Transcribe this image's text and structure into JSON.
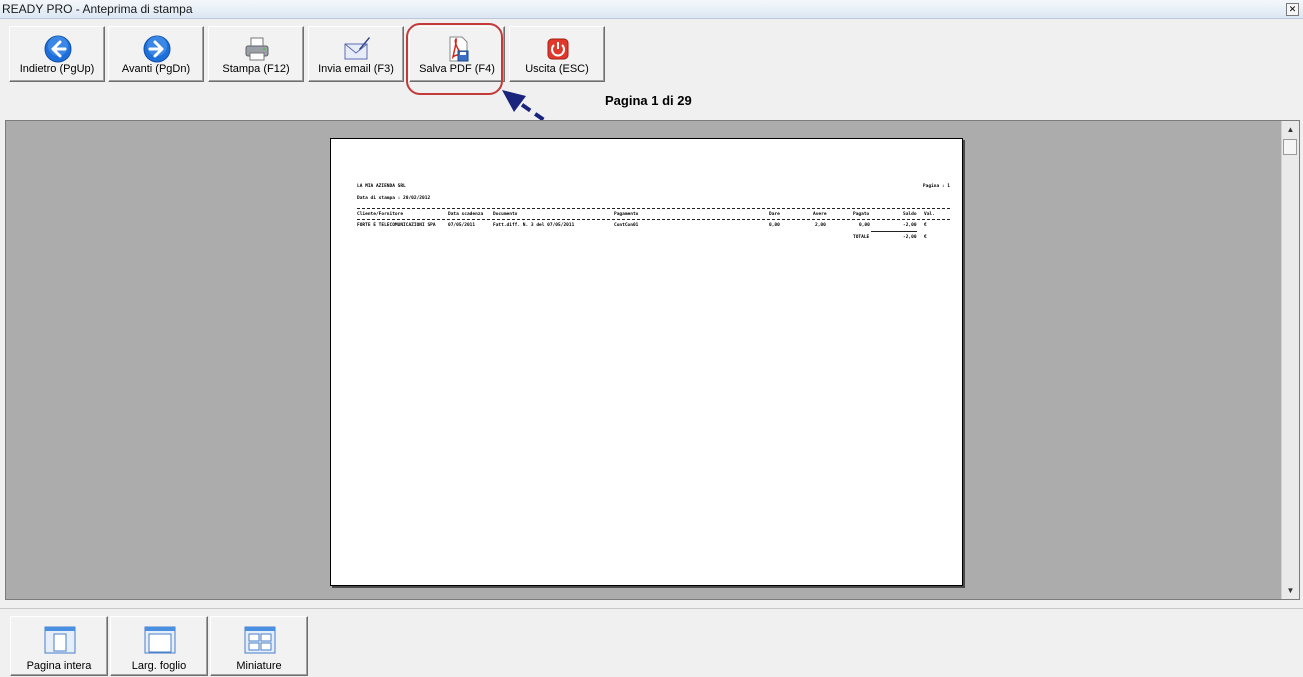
{
  "window": {
    "title": "READY PRO - Anteprima di stampa",
    "close_icon": "close-icon"
  },
  "toolbar": {
    "back_label": "Indietro (PgUp)",
    "forward_label": "Avanti (PgDn)",
    "print_label": "Stampa (F12)",
    "email_label": "Invia email (F3)",
    "pdf_label": "Salva PDF (F4)",
    "exit_label": "Uscita (ESC)"
  },
  "page_info": "Pagina 1 di 29",
  "report": {
    "company": "LA MIA AZIENDA SRL",
    "page_label": "Pagina : 1",
    "print_date": "Data di stampa : 20/02/2012",
    "columns": [
      "Cliente/Fornitore",
      "Data scadenza",
      "Documento",
      "Pagamento",
      "Dare",
      "Avere",
      "Pagato",
      "Saldo",
      "Val."
    ],
    "rows": [
      [
        "FORTE E TELECOMUNICAZIONI SPA",
        "07/05/2011",
        "Fatt.diff. N. 3 del 07/05/2011",
        "ContCon01",
        "0,00",
        "2,00",
        "0,00",
        "-2,00",
        "€"
      ]
    ],
    "total_label": "TOTALE",
    "total_value": "-2,00",
    "total_currency": "€"
  },
  "bottom": {
    "full_page_label": "Pagina intera",
    "page_width_label": "Larg. foglio",
    "thumbnails_label": "Miniature"
  },
  "colors": {
    "highlight": "#c23a3a",
    "arrow": "#1a237e",
    "preview_bg": "#acacac"
  }
}
